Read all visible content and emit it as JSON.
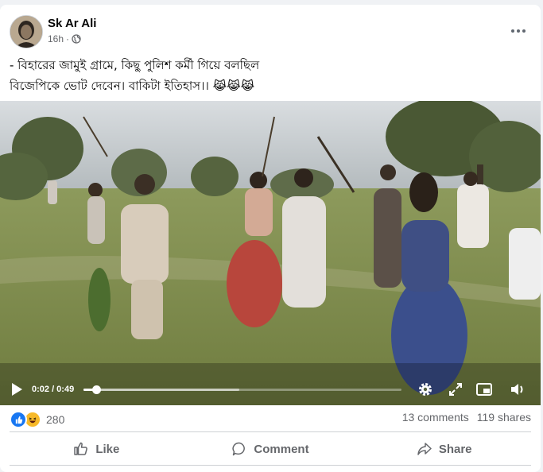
{
  "post": {
    "author": "Sk Ar Ali",
    "time": "16h",
    "privacy_icon": "globe-icon",
    "more_icon": "more-icon",
    "text_line1": "- বিহারের জামুই গ্রামে, কিছু পুলিশ কর্মী গিয়ে বলছিল",
    "text_line2": "বিজেপিকে ভোট দেবেন। বাকিটা ইতিহাস।। 😹😹😹"
  },
  "video": {
    "current_time": "0:02",
    "duration": "0:49",
    "time_display": "0:02 / 0:49",
    "progress": 0.041,
    "buffered": 0.49,
    "icons": [
      "play-icon",
      "settings-icon",
      "fullscreen-icon",
      "pip-icon",
      "volume-icon"
    ]
  },
  "stats": {
    "reaction_icons": [
      "like-reaction-icon",
      "haha-reaction-icon"
    ],
    "reaction_count": "280",
    "comments": "13 comments",
    "shares": "119 shares"
  },
  "actions": {
    "like": "Like",
    "comment": "Comment",
    "share": "Share"
  },
  "colors": {
    "brand_blue": "#1877f2",
    "secondary_text": "#65676b",
    "background": "#f0f2f5"
  }
}
